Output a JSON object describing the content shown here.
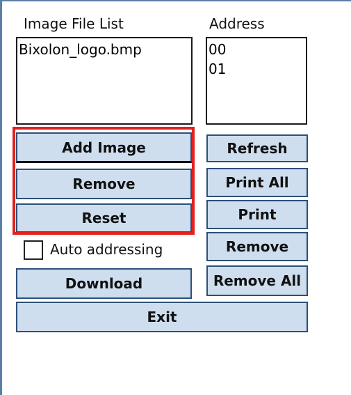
{
  "labels": {
    "image_file_list": "Image File List",
    "address": "Address"
  },
  "image_files": [
    "Bixolon_logo.bmp"
  ],
  "addresses": [
    "00",
    "01"
  ],
  "left_buttons": {
    "add_image": "Add Image",
    "remove": "Remove",
    "reset": "Reset"
  },
  "right_buttons": {
    "refresh": "Refresh",
    "print_all": "Print All",
    "print": "Print",
    "remove": "Remove",
    "remove_all": "Remove All"
  },
  "auto_addressing": {
    "label": "Auto addressing",
    "checked": false
  },
  "download": "Download",
  "exit": "Exit",
  "colors": {
    "button_fill": "#cfdeef",
    "button_border": "#2c4f78",
    "highlight": "#e0211f"
  }
}
